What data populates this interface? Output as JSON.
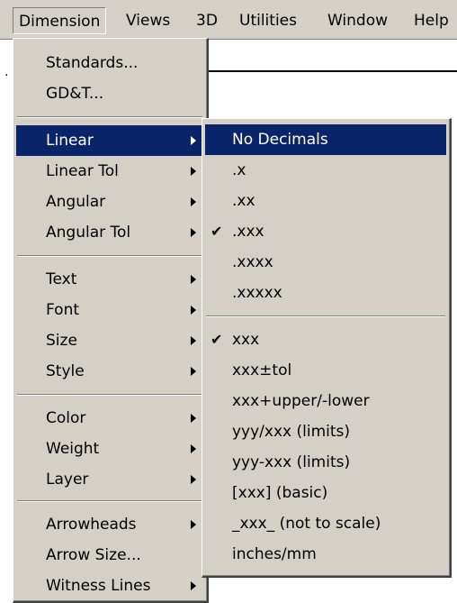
{
  "menubar": {
    "items": [
      "Dimension",
      "Views",
      "3D",
      "Utilities",
      "Window",
      "Help"
    ]
  },
  "background": {
    "mark": "."
  },
  "dimension_menu": {
    "items": [
      {
        "label": "Standards..."
      },
      {
        "label": "GD&T..."
      },
      {
        "label": "Linear",
        "submenu": true,
        "highlighted": true
      },
      {
        "label": "Linear Tol",
        "submenu": true
      },
      {
        "label": "Angular",
        "submenu": true
      },
      {
        "label": "Angular Tol",
        "submenu": true
      },
      {
        "label": "Text",
        "submenu": true
      },
      {
        "label": "Font",
        "submenu": true
      },
      {
        "label": "Size",
        "submenu": true
      },
      {
        "label": "Style",
        "submenu": true
      },
      {
        "label": "Color",
        "submenu": true
      },
      {
        "label": "Weight",
        "submenu": true
      },
      {
        "label": "Layer",
        "submenu": true
      },
      {
        "label": "Arrowheads",
        "submenu": true
      },
      {
        "label": "Arrow Size..."
      },
      {
        "label": "Witness Lines",
        "submenu": true
      }
    ]
  },
  "linear_submenu": {
    "items": [
      {
        "label": "No Decimals",
        "highlighted": true
      },
      {
        "label": ".x"
      },
      {
        "label": ".xx"
      },
      {
        "label": ".xxx",
        "checked": true
      },
      {
        "label": ".xxxx"
      },
      {
        "label": ".xxxxx"
      },
      {
        "label": "xxx",
        "checked": true
      },
      {
        "label": "xxx±tol"
      },
      {
        "label": "xxx+upper/-lower"
      },
      {
        "label": "yyy/xxx (limits)"
      },
      {
        "label": "yyy-xxx (limits)"
      },
      {
        "label": "[xxx] (basic)"
      },
      {
        "label": "_xxx_ (not to scale)"
      },
      {
        "label": "inches/mm"
      }
    ],
    "check_glyph": "✔"
  },
  "colors": {
    "menu_bg": "#d4d0c8",
    "highlight_bg": "#0a246a",
    "highlight_text": "#ffffff"
  }
}
